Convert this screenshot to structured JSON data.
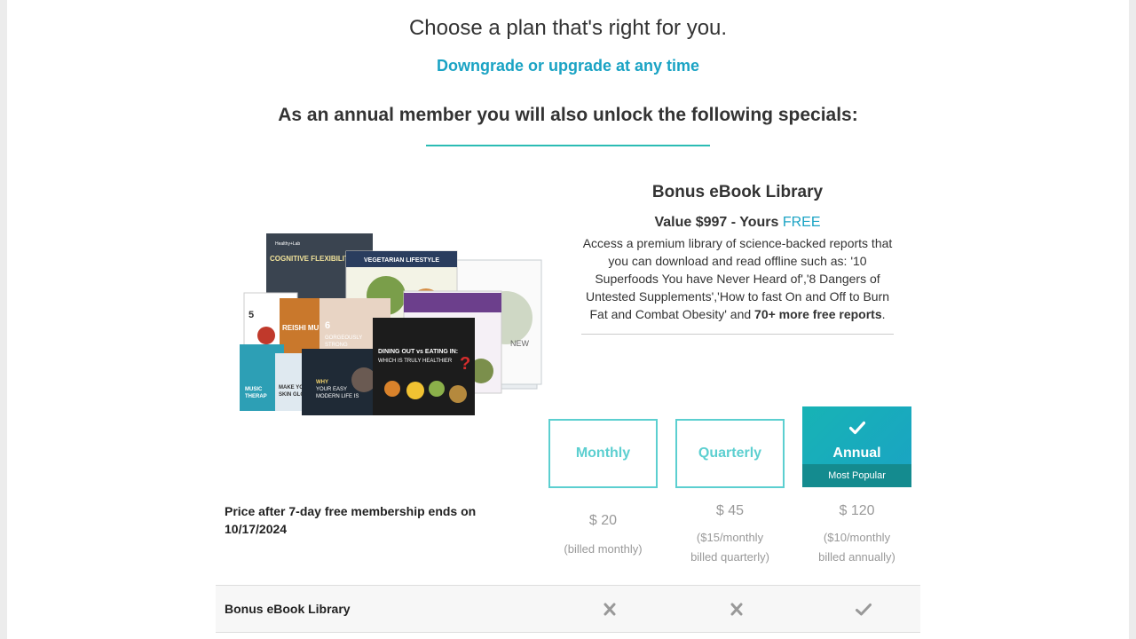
{
  "header": {
    "title": "Choose a plan that's right for you.",
    "subtitle": "Downgrade or upgrade at any time",
    "specials": "As an annual member you will also unlock the following specials:"
  },
  "bonus": {
    "title": "Bonus eBook Library",
    "value_prefix": "Value $997 - Yours ",
    "value_free": "FREE",
    "description": "Access a premium library of science-backed reports that you can download and read offline such as: '10 Superfoods You have Never Heard of','8 Dangers of Untested Supplements','How to fast On and Off to Burn Fat and Combat Obesity' and ",
    "description_bold": "70+ more free reports",
    "description_end": "."
  },
  "ebook_covers": {
    "brand": "Healthy+Lab",
    "titles": [
      "COGNITIVE FLEXIBILITY:",
      "VEGETARIAN LIFESTYLE",
      "REISHI MUSHROOM",
      "6 GORGEOUSLY STRONG",
      "DINING OUT vs EATING IN: WHICH IS TRULY HEALTHIER?",
      "WHY YOUR EASY MODERN LIFE IS RUINING YOUR BRAIN",
      "MAKE YOUR SKIN GLOW",
      "MUSIC THERAPY",
      "5 REMARKABLE"
    ]
  },
  "plans": [
    {
      "name": "Monthly",
      "selected": false
    },
    {
      "name": "Quarterly",
      "selected": false
    },
    {
      "name": "Annual",
      "selected": true,
      "badge": "Most Popular"
    }
  ],
  "pricing": {
    "label": "Price after 7-day free membership ends on 10/17/2024",
    "monthly": {
      "amount": "$ 20",
      "note": "(billed monthly)"
    },
    "quarterly": {
      "amount": "$ 45",
      "note_line1": "($15/monthly",
      "note_line2": "billed quarterly)"
    },
    "annual": {
      "amount": "$ 120",
      "note_line1": "($10/monthly",
      "note_line2": "billed annually)"
    }
  },
  "features": [
    {
      "label": "Bonus eBook Library",
      "monthly": "x-icon",
      "quarterly": "x-icon",
      "annual": "check-icon"
    }
  ],
  "colors": {
    "accent": "#1aa3c4",
    "teal": "#2bbcb4",
    "tile_border": "#5ccfd0"
  }
}
